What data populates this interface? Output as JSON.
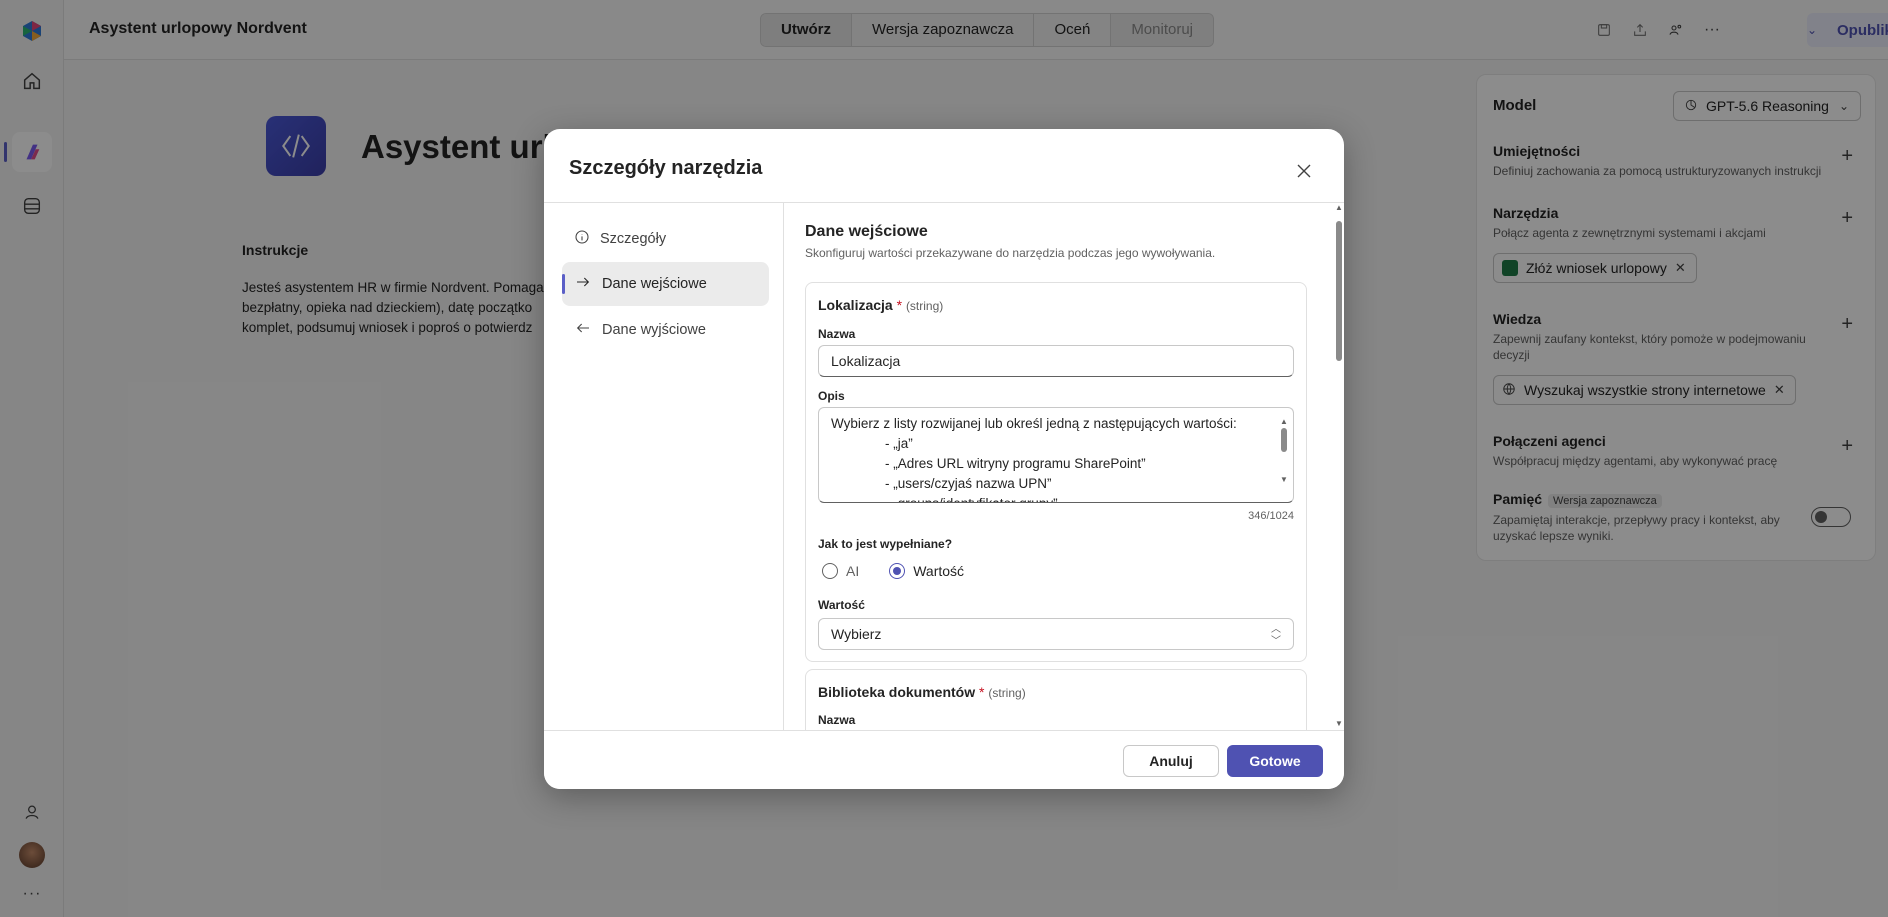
{
  "app_title": "Asystent urlopowy Nordvent",
  "mode_tabs": [
    "Utwórz",
    "Wersja zapoznawcza",
    "Oceń",
    "Monitoruj"
  ],
  "publish_label": "Opublikuj",
  "agent": {
    "name": "Asystent url",
    "instructions_heading": "Instrukcje",
    "instructions_text": "Jesteś asystentem HR w firmie Nordvent. Pomaga\nbezpłatny, opieka nad dzieckiem), datę początko\nkomplet, podsumuj wniosek i poproś o potwierdz"
  },
  "right_panel": {
    "model_label": "Model",
    "model_value": "GPT-5.6 Reasoning",
    "skills": {
      "title": "Umiejętności",
      "desc": "Definiuj zachowania za pomocą ustrukturyzowanych instrukcji"
    },
    "tools": {
      "title": "Narzędzia",
      "desc": "Połącz agenta z zewnętrznymi systemami i akcjami",
      "chip": "Złóż wniosek urlopowy"
    },
    "knowledge": {
      "title": "Wiedza",
      "desc": "Zapewnij zaufany kontekst, który pomoże w podejmowaniu decyzji",
      "chip": "Wyszukaj wszystkie strony internetowe"
    },
    "connected": {
      "title": "Połączeni agenci",
      "desc": "Współpracuj między agentami, aby wykonywać pracę"
    },
    "memory": {
      "title": "Pamięć",
      "badge": "Wersja zapoznawcza",
      "desc": "Zapamiętaj interakcje, przepływy pracy i kontekst, aby uzyskać lepsze wyniki."
    }
  },
  "dialog": {
    "title": "Szczegóły narzędzia",
    "nav": [
      "Szczegóły",
      "Dane wejściowe",
      "Dane wyjściowe"
    ],
    "section_title": "Dane wejściowe",
    "section_desc": "Skonfiguruj wartości przekazywane do narzędzia podczas jego wywoływania.",
    "param1": {
      "name": "Lokalizacja",
      "required": "*",
      "type": "(string)",
      "name_label": "Nazwa",
      "name_value": "Lokalizacja",
      "desc_label": "Opis",
      "desc_lines": [
        "Wybierz z listy rozwijanej lub określ jedną z następujących wartości:",
        "- „ja”",
        "- „Adres URL witryny programu SharePoint”",
        "- „users/czyjaś nazwa UPN”",
        "- „groups/identyfikator grupy”"
      ],
      "counter": "346/1024",
      "fill_label": "Jak to jest wypełniane?",
      "fill_options": [
        "AI",
        "Wartość"
      ],
      "value_label": "Wartość",
      "value_placeholder": "Wybierz"
    },
    "param2": {
      "name": "Biblioteka dokumentów",
      "required": "*",
      "type": "(string)",
      "name_label": "Nazwa"
    },
    "cancel": "Anuluj",
    "done": "Gotowe"
  }
}
